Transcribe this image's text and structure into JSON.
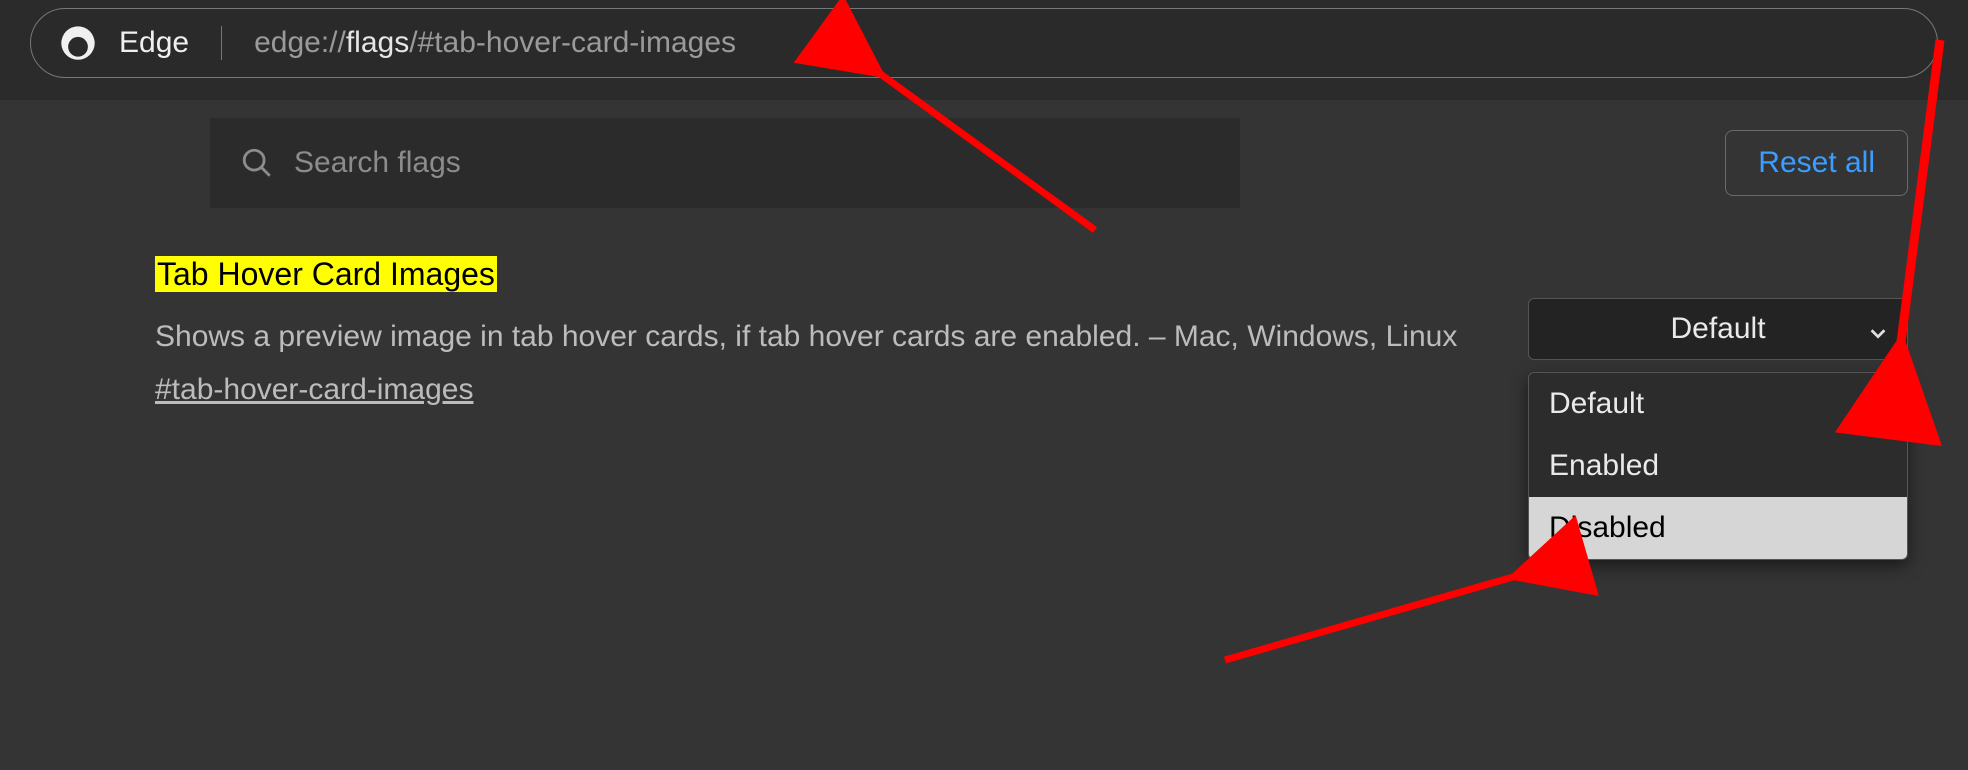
{
  "addressbar": {
    "app_name": "Edge",
    "url_scheme": "edge://",
    "url_host": "flags",
    "url_path": "/#tab-hover-card-images"
  },
  "search": {
    "placeholder": "Search flags"
  },
  "reset_button_label": "Reset all",
  "flag": {
    "title": "Tab Hover Card Images",
    "description": "Shows a preview image in tab hover cards, if tab hover cards are enabled. – Mac, Windows, Linux",
    "anchor": "#tab-hover-card-images",
    "selected": "Default",
    "options": [
      "Default",
      "Enabled",
      "Disabled"
    ],
    "highlighted_option_index": 2
  },
  "colors": {
    "highlight": "#ffff00",
    "link": "#3b9dff",
    "arrow": "#ff0000"
  }
}
